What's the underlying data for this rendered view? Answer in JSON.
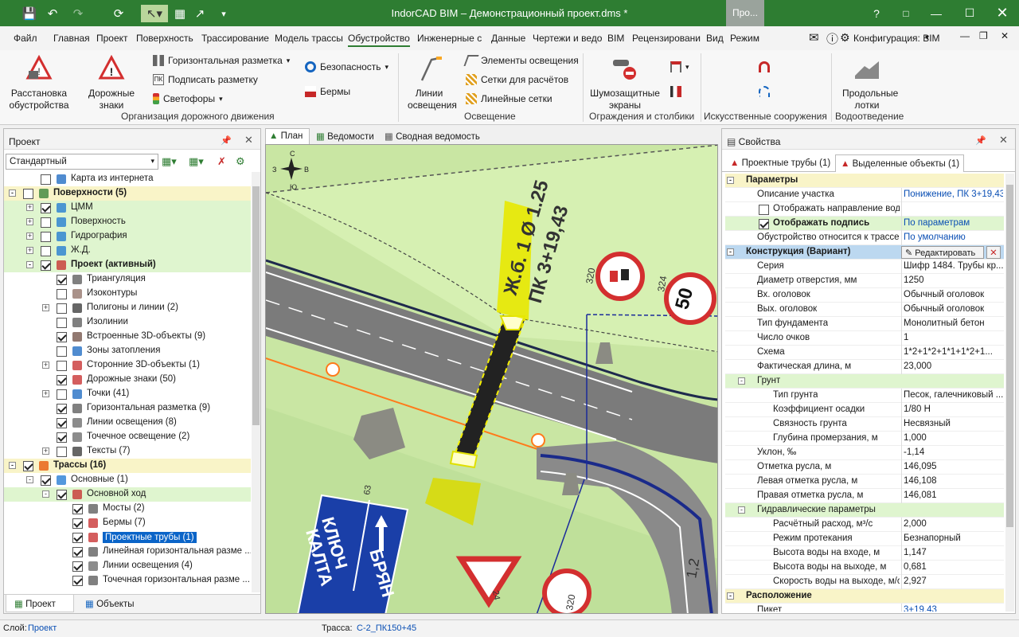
{
  "app": {
    "title": "IndorCAD BIM – Демонстрационный проект.dms *",
    "project_tab": "Про..."
  },
  "menu": [
    "Файл",
    "Главная",
    "Проект",
    "Поверхность",
    "Трассирование",
    "Модель трассы",
    "Обустройство",
    "Инженерные с",
    "Данные",
    "Чертежи и ведо",
    "BIM",
    "Рецензировани",
    "Вид",
    "Режим"
  ],
  "menu_right": {
    "config_label": "Конфигурация: BIM"
  },
  "ribbon": {
    "placement": "Расстановка обустройства",
    "road_signs": "Дорожные знаки",
    "h_marking": "Горизонтальная разметка",
    "sign_marking": "Подписать разметку",
    "traffic_lights": "Светофоры",
    "safety": "Безопасность",
    "berms": "Бермы",
    "group_traffic": "Организация дорожного движения",
    "light_lines": "Линии освещения",
    "light_elements": "Элементы освещения",
    "calc_grids": "Сетки для расчётов",
    "linear_grids": "Линейные сетки",
    "group_lighting": "Освещение",
    "noise_screens": "Шумозащитные экраны",
    "group_fences": "Ограждения и столбики",
    "group_structures": "Искусственные сооружения",
    "trays": "Продольные лотки",
    "group_drainage": "Водоотведение"
  },
  "project_panel": {
    "title": "Проект",
    "view_select": "Стандартный",
    "tabs": {
      "project": "Проект",
      "objects": "Объекты"
    },
    "rows": [
      {
        "label": "Карта из интернета",
        "level": 1,
        "cb": false,
        "exp": "",
        "style": ""
      },
      {
        "label": "Поверхности (5)",
        "level": 0,
        "cb": false,
        "exp": "-",
        "style": "sec"
      },
      {
        "label": "ЦММ",
        "level": 1,
        "cb": true,
        "exp": "+",
        "style": "green"
      },
      {
        "label": "Поверхность",
        "level": 1,
        "cb": false,
        "exp": "+",
        "style": "green"
      },
      {
        "label": "Гидрография",
        "level": 1,
        "cb": false,
        "exp": "+",
        "style": "green"
      },
      {
        "label": "Ж.Д.",
        "level": 1,
        "cb": false,
        "exp": "+",
        "style": "green"
      },
      {
        "label": "Проект (активный)",
        "level": 1,
        "cb": true,
        "exp": "-",
        "style": "green bold"
      },
      {
        "label": "Триангуляция",
        "level": 2,
        "cb": true,
        "exp": "",
        "style": ""
      },
      {
        "label": "Изоконтуры",
        "level": 2,
        "cb": false,
        "exp": "",
        "style": ""
      },
      {
        "label": "Полигоны и линии (2)",
        "level": 2,
        "cb": false,
        "exp": "+",
        "style": ""
      },
      {
        "label": "Изолинии",
        "level": 2,
        "cb": false,
        "exp": "",
        "style": ""
      },
      {
        "label": "Встроенные 3D-объекты (9)",
        "level": 2,
        "cb": true,
        "exp": "",
        "style": ""
      },
      {
        "label": "Зоны затопления",
        "level": 2,
        "cb": false,
        "exp": "",
        "style": ""
      },
      {
        "label": "Сторонние 3D-объекты (1)",
        "level": 2,
        "cb": false,
        "exp": "+",
        "style": ""
      },
      {
        "label": "Дорожные знаки (50)",
        "level": 2,
        "cb": true,
        "exp": "",
        "style": ""
      },
      {
        "label": "Точки (41)",
        "level": 2,
        "cb": false,
        "exp": "+",
        "style": ""
      },
      {
        "label": "Горизонтальная разметка (9)",
        "level": 2,
        "cb": true,
        "exp": "",
        "style": ""
      },
      {
        "label": "Линии освещения (8)",
        "level": 2,
        "cb": true,
        "exp": "",
        "style": ""
      },
      {
        "label": "Точечное освещение (2)",
        "level": 2,
        "cb": true,
        "exp": "",
        "style": ""
      },
      {
        "label": "Тексты (7)",
        "level": 2,
        "cb": false,
        "exp": "+",
        "style": ""
      },
      {
        "label": "Трассы (16)",
        "level": 0,
        "cb": true,
        "exp": "-",
        "style": "sec"
      },
      {
        "label": "Основные (1)",
        "level": 1,
        "cb": true,
        "exp": "-",
        "style": ""
      },
      {
        "label": "Основной ход",
        "level": 2,
        "cb": true,
        "exp": "-",
        "style": "green"
      },
      {
        "label": "Мосты (2)",
        "level": 3,
        "cb": true,
        "exp": "",
        "style": ""
      },
      {
        "label": "Бермы (7)",
        "level": 3,
        "cb": true,
        "exp": "",
        "style": ""
      },
      {
        "label": "Проектные трубы (1)",
        "level": 3,
        "cb": true,
        "exp": "",
        "style": "sel"
      },
      {
        "label": "Линейная горизонтальная разме ...",
        "level": 3,
        "cb": true,
        "exp": "",
        "style": ""
      },
      {
        "label": "Линии освещения (4)",
        "level": 3,
        "cb": true,
        "exp": "",
        "style": ""
      },
      {
        "label": "Точечная горизонтальная разме ...",
        "level": 3,
        "cb": true,
        "exp": "",
        "style": ""
      }
    ]
  },
  "doc_tabs": {
    "plan": "План",
    "statements": "Ведомости",
    "summary": "Сводная ведомость"
  },
  "map": {
    "pipe_label1": "Ж.б. 1 Ø 1.25",
    "pipe_label2": "ПК 3+19,43",
    "speed_limit": "50",
    "sign_text1": "КЛЮЧ",
    "sign_text2": "КАЛТА",
    "sign_text3": "БРЯН",
    "h320a": "320",
    "h324": "324",
    "h320b": "320",
    "h12": "1,2",
    "h63": "63",
    "h24": "24",
    "compass_n": "С",
    "compass_s": "Ю",
    "compass_w": "З",
    "compass_e": "В"
  },
  "props_panel": {
    "title": "Свойства",
    "tab1": "Проектные трубы (1)",
    "tab2": "Выделенные объекты (1)",
    "edit_btn": "Редактировать",
    "rows": [
      {
        "k": "Параметры",
        "v": "",
        "type": "sec",
        "indent": 0
      },
      {
        "k": "Описание участка",
        "v": "Понижение, ПК 3+19,43",
        "type": "link",
        "indent": 1
      },
      {
        "k": "Отображать направление водотока",
        "v": "",
        "type": "cb",
        "indent": 1
      },
      {
        "k": "Отображать подпись",
        "v": "По параметрам",
        "type": "cbon",
        "indent": 1
      },
      {
        "k": "Обустройство относится к трассе",
        "v": "По умолчанию",
        "type": "link",
        "indent": 1
      },
      {
        "k": "Конструкция (Вариант)",
        "v": "",
        "type": "sec2",
        "indent": 0
      },
      {
        "k": "Серия",
        "v": "Шифр 1484. Трубы кр...",
        "type": "",
        "indent": 1
      },
      {
        "k": "Диаметр отверстия, мм",
        "v": "1250",
        "type": "",
        "indent": 1
      },
      {
        "k": "Вх. оголовок",
        "v": "Обычный оголовок",
        "type": "",
        "indent": 1
      },
      {
        "k": "Вых. оголовок",
        "v": "Обычный оголовок",
        "type": "",
        "indent": 1
      },
      {
        "k": "Тип фундамента",
        "v": "Монолитный бетон",
        "type": "",
        "indent": 1
      },
      {
        "k": "Число очков",
        "v": "1",
        "type": "",
        "indent": 1
      },
      {
        "k": "Схема",
        "v": "1*2+1*2+1*1+1*2+1...",
        "type": "",
        "indent": 1
      },
      {
        "k": "Фактическая длина, м",
        "v": "23,000",
        "type": "",
        "indent": 1
      },
      {
        "k": "Грунт",
        "v": "",
        "type": "sub",
        "indent": 1
      },
      {
        "k": "Тип грунта",
        "v": "Песок, галечниковый ...",
        "type": "",
        "indent": 2
      },
      {
        "k": "Коэффициент осадки",
        "v": "1/80 Н",
        "type": "",
        "indent": 2
      },
      {
        "k": "Связность грунта",
        "v": "Несвязный",
        "type": "",
        "indent": 2
      },
      {
        "k": "Глубина промерзания, м",
        "v": "1,000",
        "type": "",
        "indent": 2
      },
      {
        "k": "Уклон, ‰",
        "v": "-1,14",
        "type": "",
        "indent": 1
      },
      {
        "k": "Отметка русла, м",
        "v": "146,095",
        "type": "",
        "indent": 1
      },
      {
        "k": "Левая отметка русла, м",
        "v": "146,108",
        "type": "",
        "indent": 1
      },
      {
        "k": "Правая отметка русла, м",
        "v": "146,081",
        "type": "",
        "indent": 1
      },
      {
        "k": "Гидравлические параметры",
        "v": "",
        "type": "sub",
        "indent": 1
      },
      {
        "k": "Расчётный расход, м³/с",
        "v": "2,000",
        "type": "",
        "indent": 2
      },
      {
        "k": "Режим протекания",
        "v": "Безнапорный",
        "type": "",
        "indent": 2
      },
      {
        "k": "Высота воды на входе, м",
        "v": "1,147",
        "type": "",
        "indent": 2
      },
      {
        "k": "Высота воды на выходе, м",
        "v": "0,681",
        "type": "",
        "indent": 2
      },
      {
        "k": "Скорость воды на выходе, м/с",
        "v": "2,927",
        "type": "",
        "indent": 2
      },
      {
        "k": "Расположение",
        "v": "",
        "type": "sec",
        "indent": 0
      },
      {
        "k": "Пикет",
        "v": "3+19,43",
        "type": "link",
        "indent": 1
      }
    ]
  },
  "status": {
    "layer_label": "Слой:",
    "layer_value": "Проект",
    "route_label": "Трасса:",
    "route_value": "С-2_ПК150+45"
  },
  "colors": {
    "accent": "#2e7d32",
    "selection": "#0a64c8",
    "link": "#0a4fb4"
  }
}
